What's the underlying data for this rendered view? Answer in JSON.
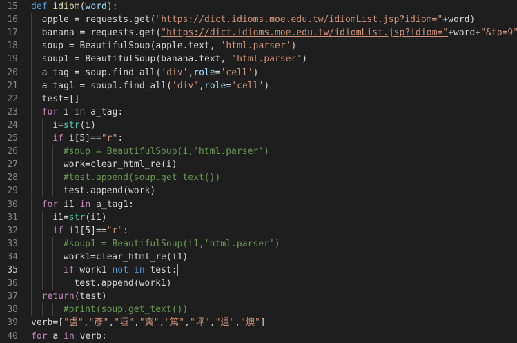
{
  "editor": {
    "current_line": 35,
    "lines": [
      {
        "n": "15",
        "indent": 0,
        "tokens": [
          [
            "kw",
            "def"
          ],
          [
            "plain",
            " "
          ],
          [
            "fn",
            "idiom"
          ],
          [
            "plain",
            "("
          ],
          [
            "param",
            "word"
          ],
          [
            "plain",
            "):"
          ]
        ]
      },
      {
        "n": "16",
        "indent": 1,
        "tokens": [
          [
            "plain",
            "apple = requests.get("
          ],
          [
            "strlink",
            "\"https://dict.idioms.moe.edu.tw/idiomList.jsp?idiom=\""
          ],
          [
            "plain",
            "+word)"
          ]
        ]
      },
      {
        "n": "17",
        "indent": 1,
        "tokens": [
          [
            "plain",
            "banana = requests.get("
          ],
          [
            "strlink",
            "\"https://dict.idioms.moe.edu.tw/idiomList.jsp?idiom=\""
          ],
          [
            "plain",
            "+word+"
          ],
          [
            "str",
            "\"&tp=9\""
          ],
          [
            "plain",
            ")"
          ]
        ]
      },
      {
        "n": "18",
        "indent": 1,
        "tokens": [
          [
            "plain",
            "soup = BeautifulSoup(apple.text, "
          ],
          [
            "str",
            "'html.parser'"
          ],
          [
            "plain",
            ")"
          ]
        ]
      },
      {
        "n": "19",
        "indent": 1,
        "tokens": [
          [
            "plain",
            "soup1 = BeautifulSoup(banana.text, "
          ],
          [
            "str",
            "'html.parser'"
          ],
          [
            "plain",
            ")"
          ]
        ]
      },
      {
        "n": "20",
        "indent": 1,
        "tokens": [
          [
            "plain",
            "a_tag = soup.find_all("
          ],
          [
            "str",
            "'div'"
          ],
          [
            "plain",
            ","
          ],
          [
            "param",
            "role"
          ],
          [
            "plain",
            "="
          ],
          [
            "str",
            "'cell'"
          ],
          [
            "plain",
            ")"
          ]
        ]
      },
      {
        "n": "21",
        "indent": 1,
        "tokens": [
          [
            "plain",
            "a_tag1 = soup1.find_all("
          ],
          [
            "str",
            "'div'"
          ],
          [
            "plain",
            ","
          ],
          [
            "param",
            "role"
          ],
          [
            "plain",
            "="
          ],
          [
            "str",
            "'cell'"
          ],
          [
            "plain",
            ")"
          ]
        ]
      },
      {
        "n": "22",
        "indent": 1,
        "tokens": [
          [
            "plain",
            "test=[]"
          ]
        ]
      },
      {
        "n": "23",
        "indent": 1,
        "tokens": [
          [
            "ctl",
            "for"
          ],
          [
            "plain",
            " i "
          ],
          [
            "ctl",
            "in"
          ],
          [
            "plain",
            " a_tag:"
          ]
        ]
      },
      {
        "n": "24",
        "indent": 2,
        "tokens": [
          [
            "plain",
            "i="
          ],
          [
            "bltn",
            "str"
          ],
          [
            "plain",
            "(i)"
          ]
        ]
      },
      {
        "n": "25",
        "indent": 2,
        "tokens": [
          [
            "ctl",
            "if"
          ],
          [
            "plain",
            " i[5]=="
          ],
          [
            "str",
            "\"r\""
          ],
          [
            "plain",
            ":"
          ]
        ]
      },
      {
        "n": "26",
        "indent": 3,
        "tokens": [
          [
            "cmt",
            "#soup = BeautifulSoup(i,'html.parser')"
          ]
        ]
      },
      {
        "n": "27",
        "indent": 3,
        "tokens": [
          [
            "plain",
            "work=clear_html_re(i)"
          ]
        ]
      },
      {
        "n": "28",
        "indent": 3,
        "tokens": [
          [
            "cmt",
            "#test.append(soup.get_text())"
          ]
        ]
      },
      {
        "n": "29",
        "indent": 3,
        "tokens": [
          [
            "plain",
            "test.append(work)"
          ]
        ]
      },
      {
        "n": "30",
        "indent": 1,
        "tokens": [
          [
            "ctl",
            "for"
          ],
          [
            "plain",
            " i1 "
          ],
          [
            "ctl",
            "in"
          ],
          [
            "plain",
            " a_tag1:"
          ]
        ]
      },
      {
        "n": "31",
        "indent": 2,
        "tokens": [
          [
            "plain",
            "i1="
          ],
          [
            "bltn",
            "str"
          ],
          [
            "plain",
            "(i1)"
          ]
        ]
      },
      {
        "n": "32",
        "indent": 2,
        "tokens": [
          [
            "ctl",
            "if"
          ],
          [
            "plain",
            " i1[5]=="
          ],
          [
            "str",
            "\"r\""
          ],
          [
            "plain",
            ":"
          ]
        ]
      },
      {
        "n": "33",
        "indent": 3,
        "tokens": [
          [
            "cmt",
            "#soup1 = BeautifulSoup(i1,'html.parser')"
          ]
        ]
      },
      {
        "n": "34",
        "indent": 3,
        "tokens": [
          [
            "plain",
            "work1=clear_html_re(i1)"
          ]
        ]
      },
      {
        "n": "35",
        "indent": 3,
        "tokens": [
          [
            "ctl",
            "if"
          ],
          [
            "plain",
            " work1 "
          ],
          [
            "kw",
            "not"
          ],
          [
            "plain",
            " "
          ],
          [
            "kw",
            "in"
          ],
          [
            "plain",
            " test:"
          ]
        ]
      },
      {
        "n": "36",
        "indent": 4,
        "tokens": [
          [
            "plain",
            "test.append(work1)"
          ]
        ]
      },
      {
        "n": "37",
        "indent": 1,
        "tokens": [
          [
            "ctl",
            "return"
          ],
          [
            "plain",
            "(test)"
          ]
        ]
      },
      {
        "n": "38",
        "indent": 3,
        "tokens": [
          [
            "cmt",
            "#print(soup.get_text())"
          ]
        ]
      },
      {
        "n": "39",
        "indent": 0,
        "tokens": [
          [
            "plain",
            "verb=["
          ],
          [
            "str",
            "\"盧\""
          ],
          [
            "plain",
            ","
          ],
          [
            "str",
            "\"彥\""
          ],
          [
            "plain",
            ","
          ],
          [
            "str",
            "\"垣\""
          ],
          [
            "plain",
            ","
          ],
          [
            "str",
            "\"奭\""
          ],
          [
            "plain",
            ","
          ],
          [
            "str",
            "\"篤\""
          ],
          [
            "plain",
            ","
          ],
          [
            "str",
            "\"坪\""
          ],
          [
            "plain",
            ","
          ],
          [
            "str",
            "\"遺\""
          ],
          [
            "plain",
            ","
          ],
          [
            "str",
            "\"燠\""
          ],
          [
            "plain",
            "]"
          ]
        ]
      },
      {
        "n": "40",
        "indent": 0,
        "tokens": [
          [
            "ctl",
            "for"
          ],
          [
            "plain",
            " a "
          ],
          [
            "ctl",
            "in"
          ],
          [
            "plain",
            " verb:"
          ]
        ]
      }
    ]
  }
}
